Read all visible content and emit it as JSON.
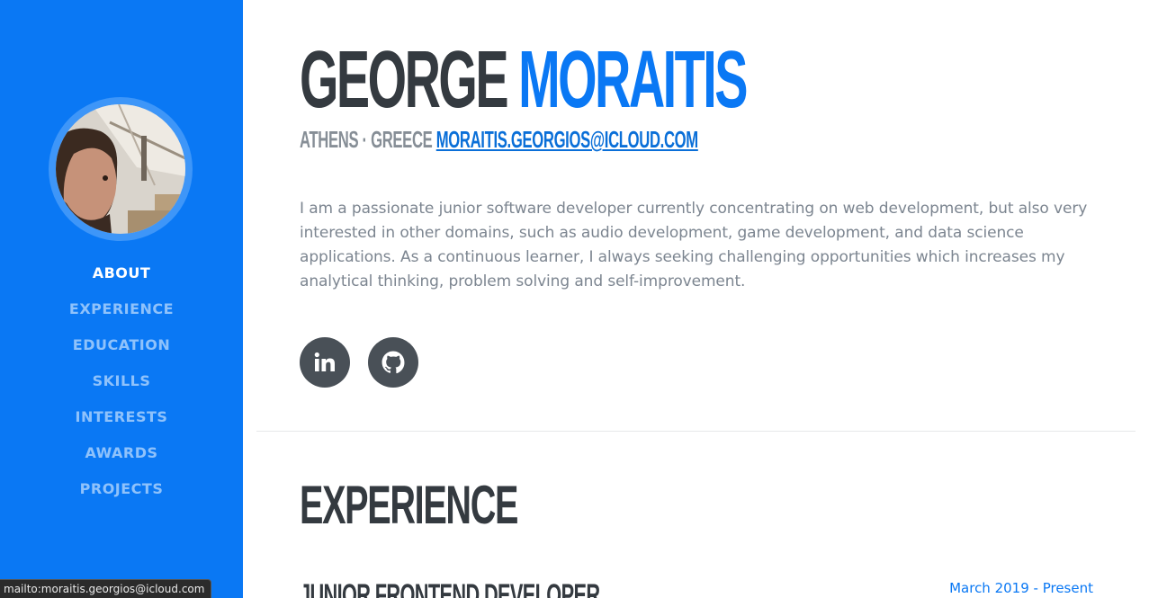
{
  "sidebar": {
    "nav": [
      "About",
      "Experience",
      "Education",
      "Skills",
      "Interests",
      "Awards",
      "Projects"
    ],
    "active": "About"
  },
  "header": {
    "first_name": "GEORGE",
    "last_name": "MORAITIS",
    "location": "ATHENS · GREECE",
    "email": "MORAITIS.GEORGIOS@ICLOUD.COM"
  },
  "about": {
    "text": "I am a passionate junior software developer currently concentrating on web development, but also very interested in other domains, such as audio development, game development, and data science applications. As a continuous learner, I always seeking challenging opportunities which increases my analytical thinking, problem solving and self-improvement."
  },
  "social": [
    {
      "icon": "linkedin-icon"
    },
    {
      "icon": "github-icon"
    }
  ],
  "experience": {
    "title": "EXPERIENCE",
    "job_title": "JUNIOR FRONTEND DEVELOPER",
    "job_date": "March 2019 - Present"
  },
  "status_bar": {
    "url": "mailto:moraitis.georgios@icloud.com"
  },
  "colors": {
    "primary": "#0a78f4",
    "dark": "#343a40",
    "muted": "#868e96",
    "social_bg": "#495057"
  }
}
